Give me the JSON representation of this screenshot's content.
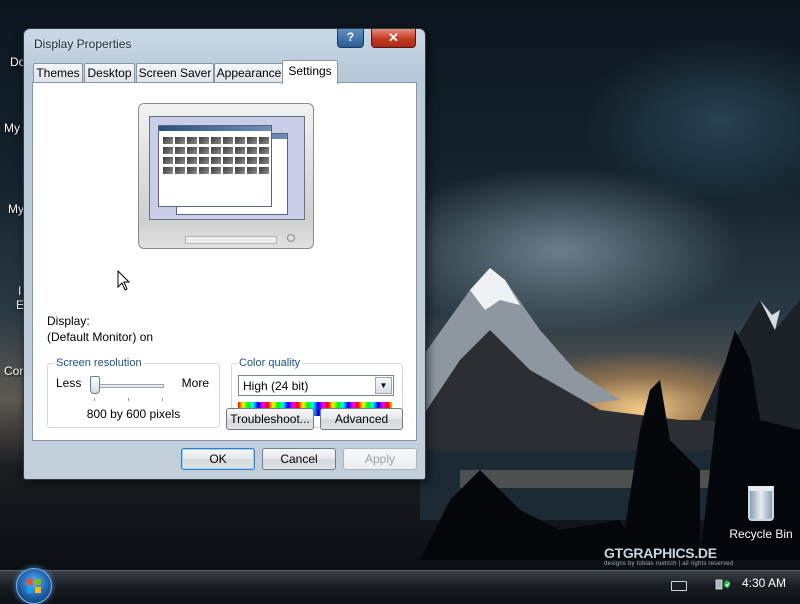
{
  "desktop": {
    "icon_labels_left": [
      "Do",
      "My",
      "My",
      "I",
      "E",
      "Com"
    ],
    "recycle_bin_label": "Recycle Bin",
    "watermark": "GTGRAPHICS.DE",
    "watermark_sub": "designs by tobias roetsch | all rights reserved"
  },
  "taskbar": {
    "clock": "4:30 AM"
  },
  "dialog": {
    "title": "Display Properties",
    "help_label": "?",
    "close_label": "✕",
    "tabs": [
      {
        "label": "Themes"
      },
      {
        "label": "Desktop"
      },
      {
        "label": "Screen Saver"
      },
      {
        "label": "Appearance"
      },
      {
        "label": "Settings"
      }
    ],
    "active_tab": "Settings",
    "display_label": "Display:",
    "display_value": "(Default Monitor) on",
    "screen_resolution": {
      "legend": "Screen resolution",
      "less": "Less",
      "more": "More",
      "value": "800 by 600 pixels",
      "slider_position": 0.0
    },
    "color_quality": {
      "legend": "Color quality",
      "selected": "High (24 bit)"
    },
    "buttons": {
      "troubleshoot": "Troubleshoot...",
      "advanced": "Advanced",
      "ok": "OK",
      "cancel": "Cancel",
      "apply": "Apply"
    }
  },
  "colors": {
    "legend_blue": "#1f4f88",
    "ok_border": "#2f7ec1",
    "close_red": "#c33a22"
  }
}
